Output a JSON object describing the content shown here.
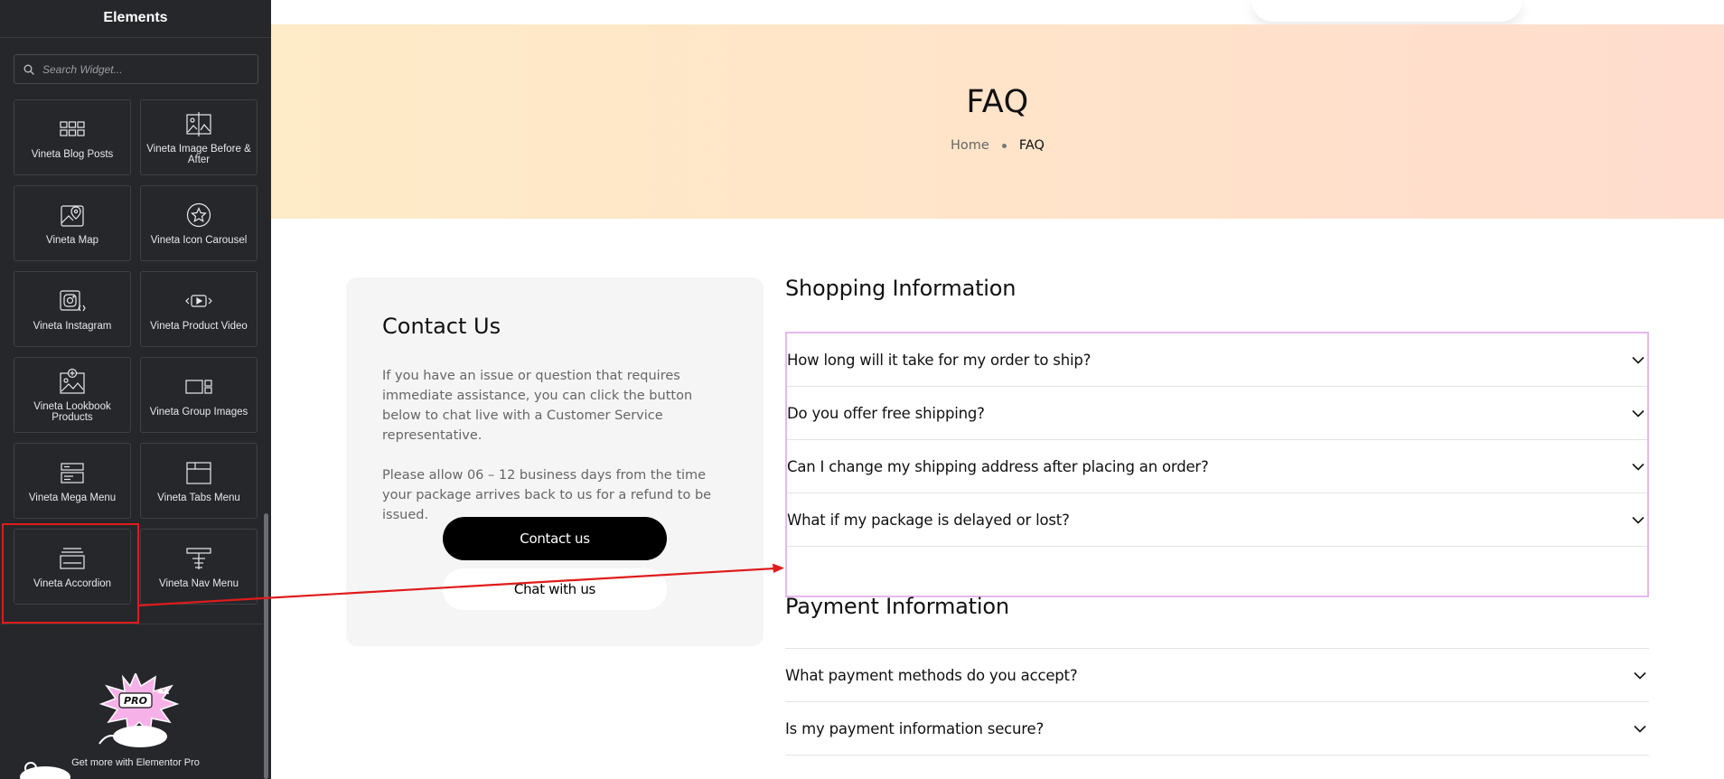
{
  "sidebar": {
    "title": "Elements",
    "search_placeholder": "Search Widget...",
    "widgets": [
      {
        "label": "Vineta Blog Posts",
        "icon": "blog-posts-icon"
      },
      {
        "label": "Vineta Image Before & After",
        "icon": "image-before-after-icon"
      },
      {
        "label": "Vineta Map",
        "icon": "map-icon"
      },
      {
        "label": "Vineta Icon Carousel",
        "icon": "icon-carousel-icon"
      },
      {
        "label": "Vineta Instagram",
        "icon": "instagram-icon"
      },
      {
        "label": "Vineta Product Video",
        "icon": "product-video-icon"
      },
      {
        "label": "Vineta Lookbook Products",
        "icon": "lookbook-icon"
      },
      {
        "label": "Vineta Group Images",
        "icon": "group-images-icon"
      },
      {
        "label": "Vineta Mega Menu",
        "icon": "mega-menu-icon"
      },
      {
        "label": "Vineta Tabs Menu",
        "icon": "tabs-menu-icon"
      },
      {
        "label": "Vineta Accordion",
        "icon": "accordion-icon"
      },
      {
        "label": "Vineta Nav Menu",
        "icon": "nav-menu-icon"
      }
    ],
    "promo_badge": "PRO",
    "promo_text": "Get more with Elementor Pro"
  },
  "hero": {
    "title": "FAQ",
    "breadcrumb_home": "Home",
    "breadcrumb_current": "FAQ"
  },
  "contact": {
    "title": "Contact Us",
    "paragraph1": "If you have an issue or question that requires immediate assistance, you can click the button below to chat live with a Customer Service representative.",
    "paragraph2": "Please allow 06 – 12 business days from the time your package arrives back to us for a refund to be issued.",
    "primary_button": "Contact us",
    "secondary_button": "Chat with us"
  },
  "faq": {
    "shopping_title": "Shopping Information",
    "shopping_questions": [
      "How long will it take for my order to ship?",
      "Do you offer free shipping?",
      "Can I change my shipping address after placing an order?",
      "What if my package is delayed or lost?"
    ],
    "payment_title": "Payment Information",
    "payment_questions": [
      "What payment methods do you accept?",
      "Is my payment information secure?"
    ]
  },
  "colors": {
    "sidebar_bg": "#26272b",
    "highlight_red": "#e01b1b",
    "accordion_outline": "#e6b8ef",
    "hero_start": "#feebc7",
    "hero_end": "#ffdcce"
  }
}
